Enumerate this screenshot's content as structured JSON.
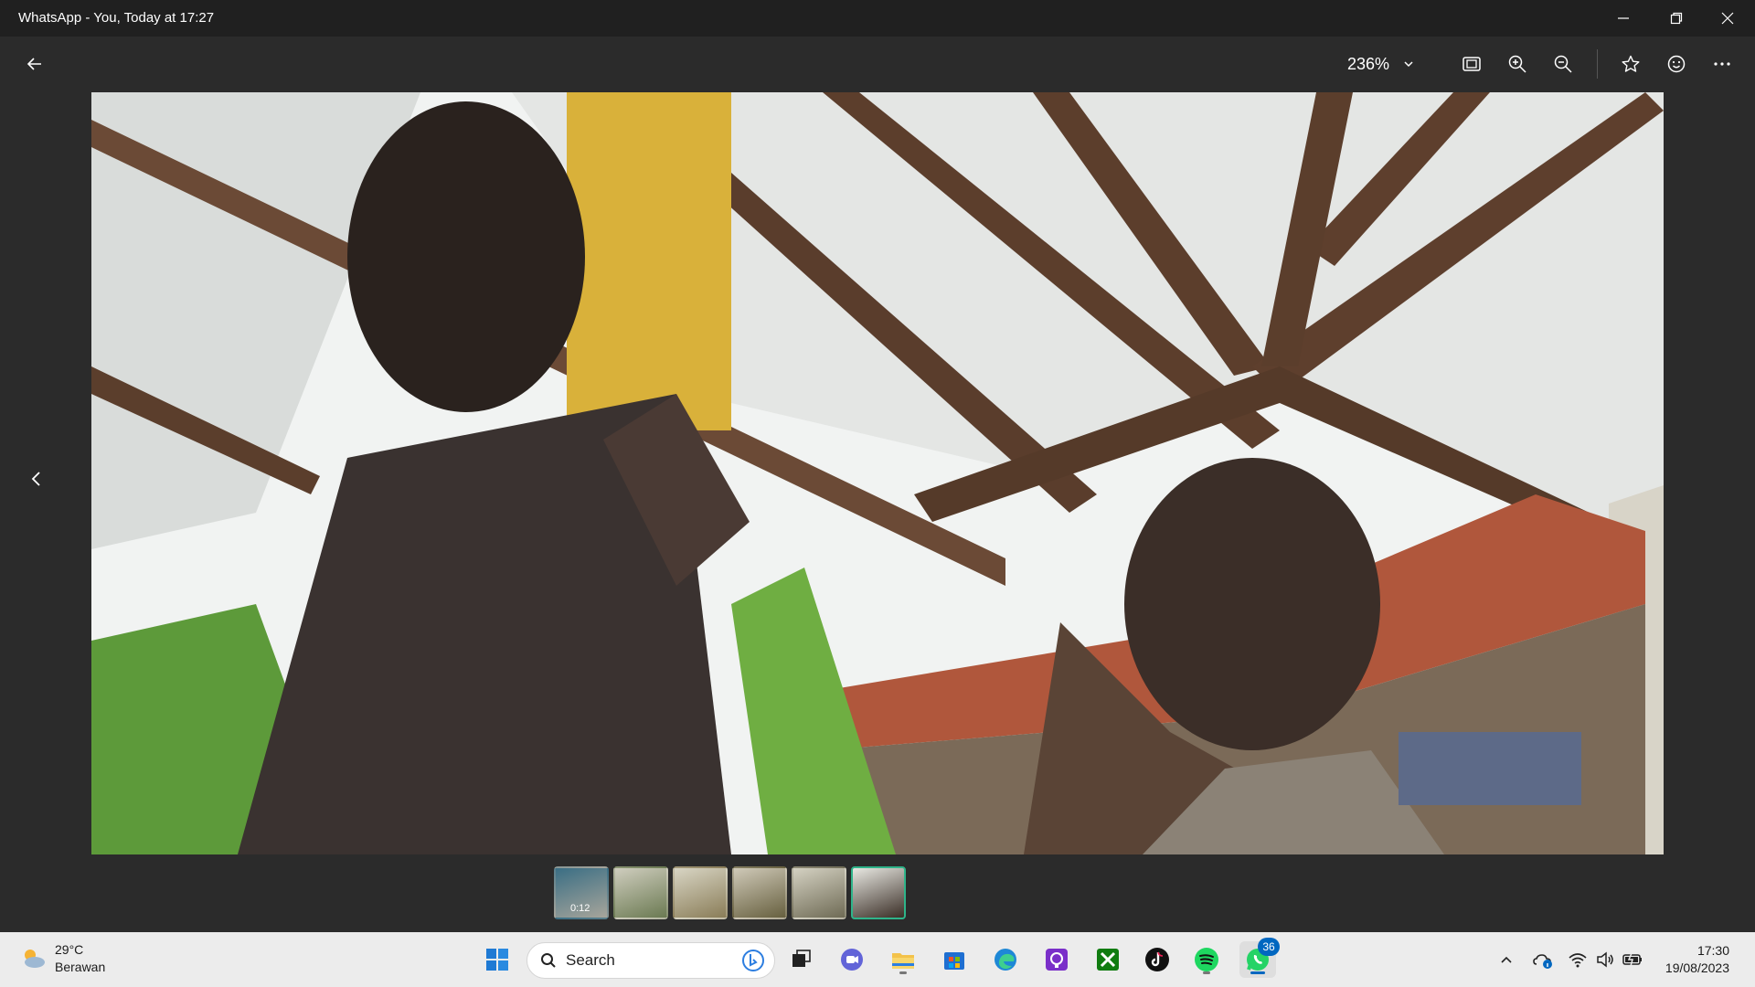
{
  "window": {
    "title": "WhatsApp - You, Today at 17:27",
    "minimize_icon": "minimize-icon",
    "restore_icon": "restore-icon",
    "close_icon": "close-icon"
  },
  "toolbar": {
    "back_icon": "arrow-left-icon",
    "zoom_level": "236%",
    "zoom_dropdown_icon": "chevron-down-icon",
    "actions": [
      "fit-screen-icon",
      "zoom-in-icon",
      "zoom-out-icon",
      "star-icon",
      "emoji-icon",
      "more-icon"
    ]
  },
  "viewer": {
    "prev_icon": "chevron-left-icon",
    "filmstrip": [
      {
        "duration": "0:12",
        "active": false
      },
      {
        "duration": "",
        "active": false
      },
      {
        "duration": "",
        "active": false
      },
      {
        "duration": "",
        "active": false
      },
      {
        "duration": "",
        "active": false
      },
      {
        "duration": "",
        "active": true
      }
    ]
  },
  "taskbar": {
    "weather": {
      "temp": "29°C",
      "condition": "Berawan"
    },
    "search": {
      "placeholder": "Search"
    },
    "apps": [
      "windows-start-icon",
      "task-view-icon",
      "teams-chat-icon",
      "file-explorer-icon",
      "ms-store-icon",
      "edge-icon",
      "app-icon",
      "xbox-icon",
      "tiktok-icon",
      "spotify-icon",
      "whatsapp-icon"
    ],
    "whatsapp_badge": "36",
    "clock": {
      "time": "17:30",
      "date": "19/08/2023"
    }
  },
  "colors": {
    "titlebar": "#202020",
    "toolbar": "#2b2b2b",
    "taskbar": "#ececec",
    "accent": "#0067c0",
    "active_thumb": "#2fb48a"
  }
}
